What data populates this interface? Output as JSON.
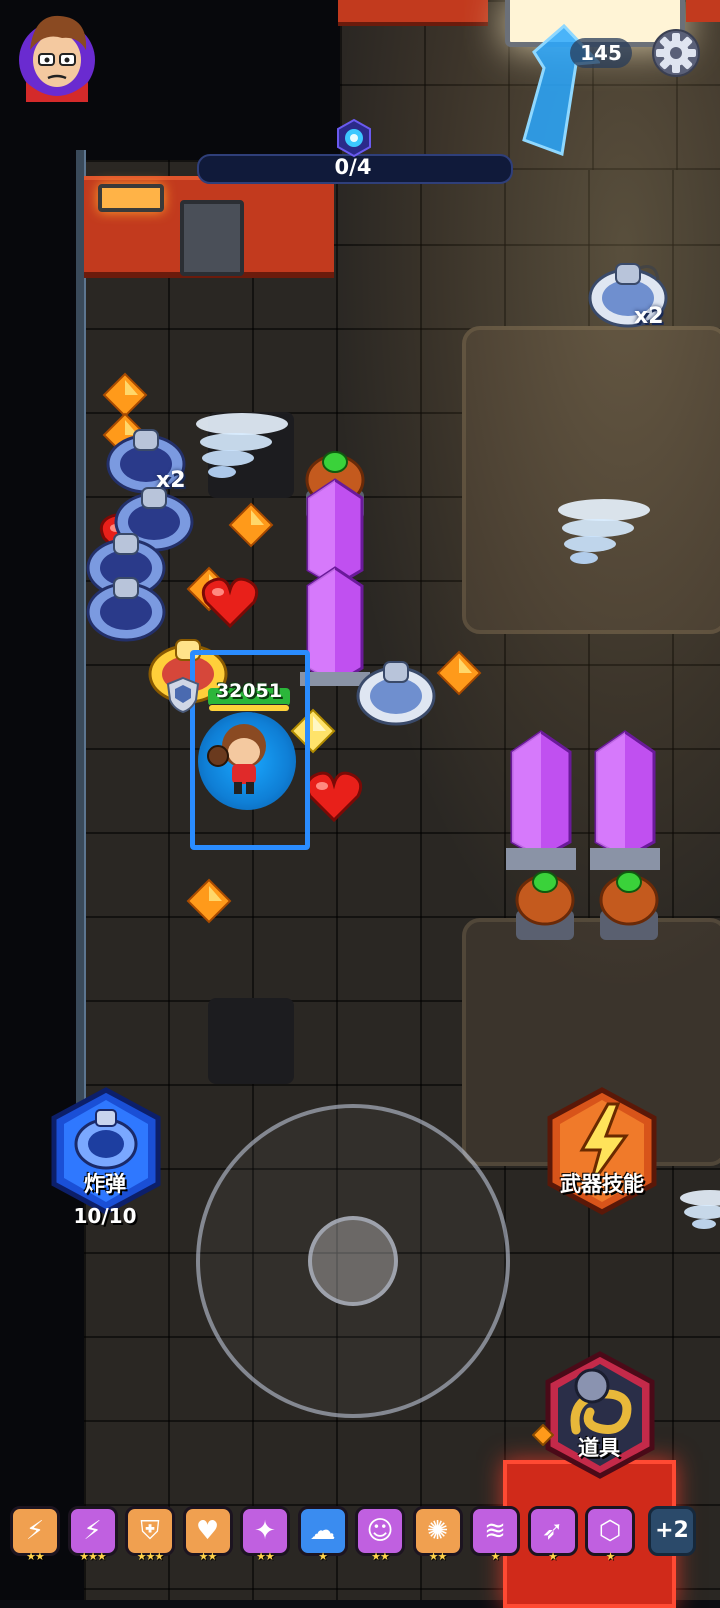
{
  "hud": {
    "coins": "145",
    "wave_progress": "0/4",
    "player_hp": "32051",
    "player_hp_fill": 1.0
  },
  "skills": {
    "bomb_label": "炸弹",
    "bomb_count": "10/10",
    "weapon_skill_label": "武器技能",
    "item_label": "道具"
  },
  "enemy_multipliers": [
    "x2",
    "x2"
  ],
  "buffs": {
    "items": [
      {
        "icon": "lightning-orb-icon",
        "color": "#f0a050",
        "stars": "★★"
      },
      {
        "icon": "lightning-burst-icon",
        "color": "#c060e0",
        "stars": "★★★"
      },
      {
        "icon": "shield-lightning-icon",
        "color": "#f0a050",
        "stars": "★★★"
      },
      {
        "icon": "heart-card-icon",
        "color": "#f0a050",
        "stars": "★★"
      },
      {
        "icon": "flame-slash-icon",
        "color": "#c060e0",
        "stars": "★★"
      },
      {
        "icon": "ghost-plus-icon",
        "color": "#3a8cf0",
        "stars": "★"
      },
      {
        "icon": "robot-face-icon",
        "color": "#c060e0",
        "stars": "★★"
      },
      {
        "icon": "spark-ball-icon",
        "color": "#f0a050",
        "stars": "★★"
      },
      {
        "icon": "tornado-icon",
        "color": "#c060e0",
        "stars": "★"
      },
      {
        "icon": "wind-blade-icon",
        "color": "#c060e0",
        "stars": "★"
      },
      {
        "icon": "hex-shield-icon",
        "color": "#c060e0",
        "stars": "★"
      }
    ],
    "more": "+2"
  },
  "colors": {
    "accent_blue": "#2a8cff",
    "hp_green": "#2bb63a",
    "crystal_purple": "#c050f0",
    "gem_orange": "#ff9a1a",
    "heart_red": "#e8201a"
  }
}
